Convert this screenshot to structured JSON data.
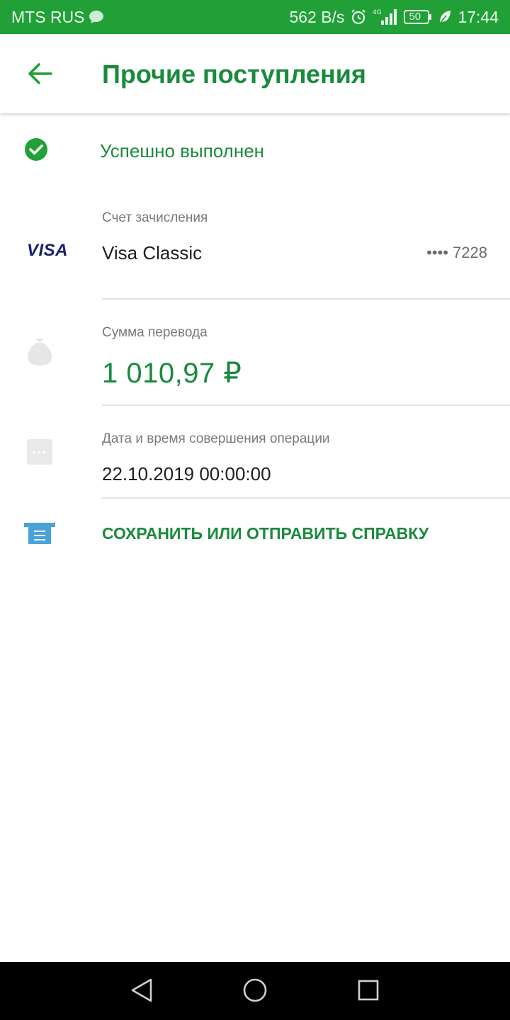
{
  "status_bar": {
    "carrier": "MTS RUS",
    "net_speed": "562 B/s",
    "network_type": "4G",
    "battery": "50",
    "time": "17:44"
  },
  "header": {
    "title": "Прочие поступления"
  },
  "status": {
    "text": "Успешно выполнен"
  },
  "account": {
    "label": "Счет зачисления",
    "logo": "VISA",
    "name": "Visa Classic",
    "mask": "•••• 7228"
  },
  "amount": {
    "label": "Сумма перевода",
    "value": "1 010,97 ₽"
  },
  "datetime": {
    "label": "Дата и время совершения операции",
    "value": "22.10.2019 00:00:00"
  },
  "actions": {
    "save_label": "СОХРАНИТЬ ИЛИ ОТПРАВИТЬ СПРАВКУ"
  },
  "colors": {
    "brand_green": "#21a038",
    "text_green": "#1a8a3d",
    "visa_blue": "#1a1f71",
    "receipt_blue": "#4aa3d6"
  },
  "icons": {
    "back": "arrow-left-icon",
    "status": "check-circle-icon",
    "amount": "money-bag-icon",
    "datetime": "dots-icon",
    "save": "receipt-icon"
  }
}
